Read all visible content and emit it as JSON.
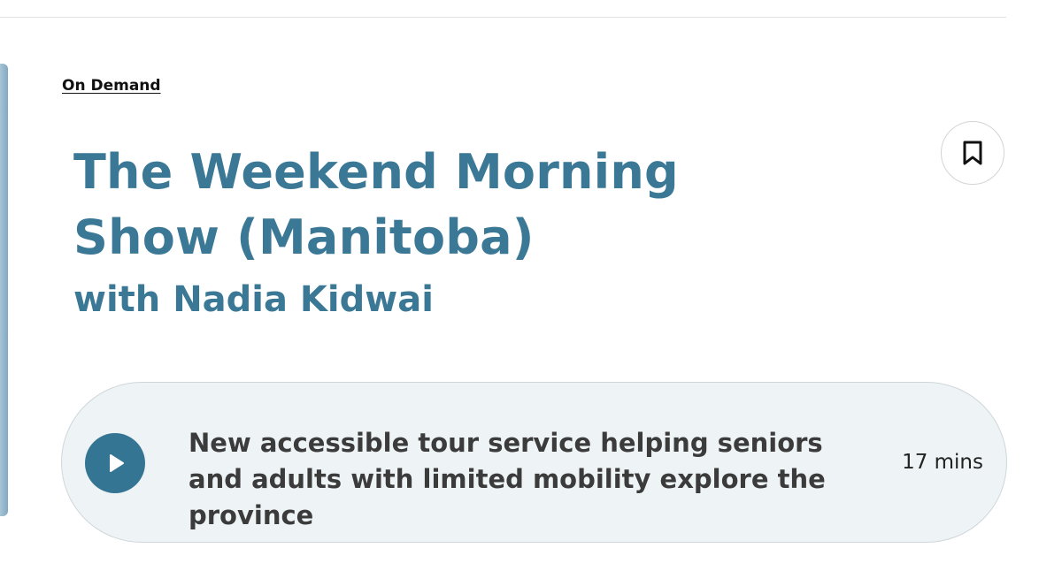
{
  "category": {
    "label": "On Demand"
  },
  "show": {
    "title": "The Weekend Morning Show (Manitoba)",
    "host": "with Nadia Kidwai"
  },
  "icons": {
    "bookmark": "bookmark-icon",
    "play": "play-icon"
  },
  "episode": {
    "title": "New accessible tour service helping seniors and adults with limited mobility explore the province",
    "duration": "17 mins"
  },
  "colors": {
    "accent": "#3a7896",
    "play_button": "#357594",
    "card_background": "#eef3f6"
  }
}
